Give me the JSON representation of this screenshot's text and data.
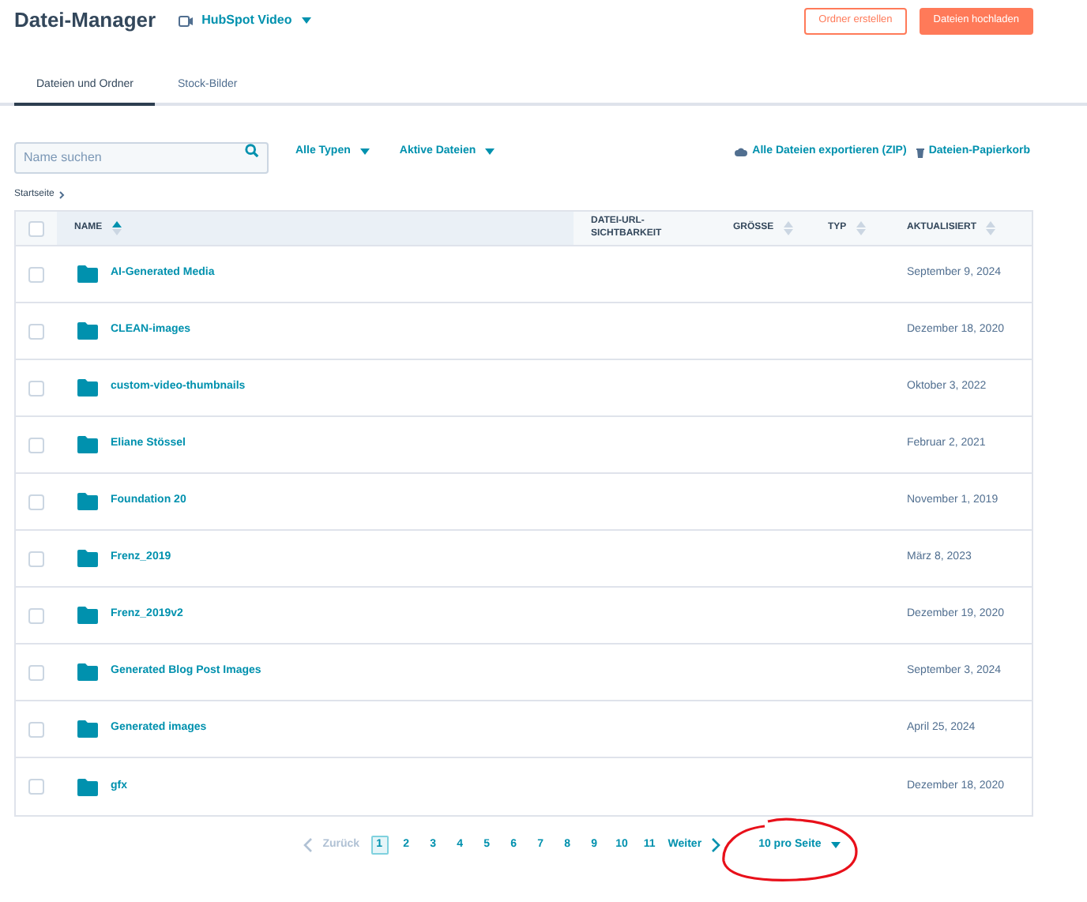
{
  "header": {
    "title": "Datei-Manager",
    "account": "HubSpot Video",
    "buttons": [
      {
        "label": "Ordner erstellen",
        "kind": "secondary"
      },
      {
        "label": "Dateien hochladen",
        "kind": "primary"
      }
    ]
  },
  "tabs": [
    {
      "label": "Dateien und Ordner",
      "selected": true
    },
    {
      "label": "Stock-Bilder",
      "selected": false
    }
  ],
  "search": {
    "placeholder": "Name suchen"
  },
  "filters": [
    "Alle Typen",
    "Aktive Dateien"
  ],
  "actions": [
    {
      "label": "Alle Dateien exportieren (ZIP)",
      "kind": "export"
    },
    {
      "label": "Dateien-Papierkorb",
      "kind": "trash"
    }
  ],
  "breadcrumb": "Startseite",
  "table": {
    "select_all_checked": false,
    "columns": [
      {
        "label": "NAME",
        "sorted": true
      },
      {
        "label": "DATEI-URL-SICHTBARKEIT",
        "sorted": false,
        "sortable": false
      },
      {
        "label": "GRÖSSE",
        "sorted": false,
        "sortable": true
      },
      {
        "label": "TYP",
        "sorted": false,
        "sortable": true
      },
      {
        "label": "AKTUALISIERT",
        "sorted": false,
        "sortable": true
      }
    ],
    "rows": [
      {
        "name": "AI-Generated Media",
        "updated": "September 9, 2024",
        "checked": false
      },
      {
        "name": "CLEAN-images",
        "updated": "Dezember 18, 2020",
        "checked": false
      },
      {
        "name": "custom-video-thumbnails",
        "updated": "Oktober 3, 2022",
        "checked": false
      },
      {
        "name": "Eliane Stössel",
        "updated": "Februar 2, 2021",
        "checked": false
      },
      {
        "name": "Foundation 20",
        "updated": "November 1, 2019",
        "checked": false
      },
      {
        "name": "Frenz_2019",
        "updated": "März 8, 2023",
        "checked": false
      },
      {
        "name": "Frenz_2019v2",
        "updated": "Dezember 19, 2020",
        "checked": false
      },
      {
        "name": "Generated Blog Post Images",
        "updated": "September 3, 2024",
        "checked": false
      },
      {
        "name": "Generated images",
        "updated": "April 25, 2024",
        "checked": false
      },
      {
        "name": "gfx",
        "updated": "Dezember 18, 2020",
        "checked": false
      }
    ]
  },
  "pagination": {
    "prev": {
      "label": "Zurück",
      "disabled": true
    },
    "next": {
      "label": "Weiter",
      "disabled": false
    },
    "pages": [
      {
        "label": "1",
        "selected": true
      },
      {
        "label": "2",
        "selected": false
      },
      {
        "label": "3",
        "selected": false
      },
      {
        "label": "4",
        "selected": false
      },
      {
        "label": "5",
        "selected": false
      },
      {
        "label": "6",
        "selected": false
      },
      {
        "label": "7",
        "selected": false
      },
      {
        "label": "8",
        "selected": false
      },
      {
        "label": "9",
        "selected": false
      },
      {
        "label": "10",
        "selected": false
      },
      {
        "label": "11",
        "selected": false
      }
    ],
    "per_page": "10 pro Seite",
    "annotated": true
  }
}
